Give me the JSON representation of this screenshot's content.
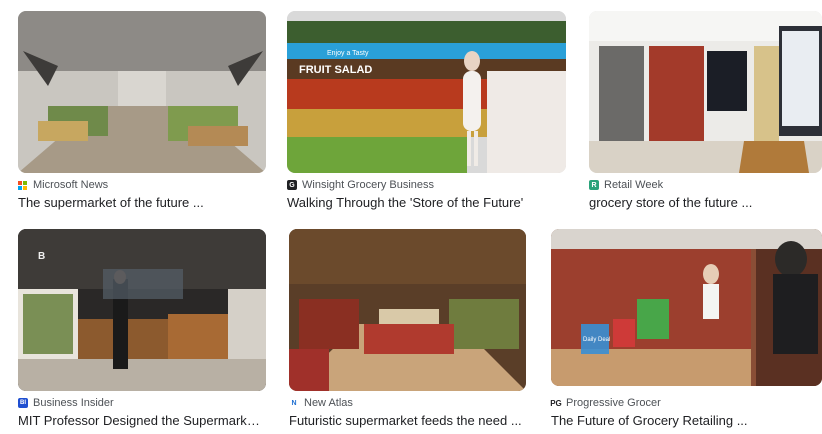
{
  "results": [
    {
      "source": "Microsoft News",
      "title": "The supermarket of the future ...",
      "icon": "microsoft-logo-icon",
      "icon_text": ""
    },
    {
      "source": "Winsight Grocery Business",
      "title": "Walking Through the 'Store of the Future'",
      "icon": "winsight-logo-icon",
      "icon_text": "G"
    },
    {
      "source": "Retail Week",
      "title": "grocery store of the future ...",
      "icon": "retail-week-logo-icon",
      "icon_text": "R"
    },
    {
      "source": "Business Insider",
      "title": "MIT Professor Designed the Supermarket...",
      "icon": "business-insider-logo-icon",
      "icon_text": "BI"
    },
    {
      "source": "New Atlas",
      "title": "Futuristic supermarket feeds the need ...",
      "icon": "new-atlas-logo-icon",
      "icon_text": "N"
    },
    {
      "source": "Progressive Grocer",
      "title": "The Future of Grocery Retailing ...",
      "icon": "progressive-grocer-logo-icon",
      "icon_text": "PG"
    }
  ],
  "image_text": {
    "fruit_salad": "FRUIT SALAD",
    "enjoy": "Enjoy a Tasty",
    "daily_deal": "Daily Deal",
    "bi_letter": "B"
  },
  "colors": {
    "ms_red": "#f25022",
    "ms_green": "#7fba00",
    "ms_blue": "#00a4ef",
    "ms_yellow": "#ffb900",
    "winsight": "#202124",
    "retail_week": "#2aa37a",
    "business_insider": "#1f4fd1",
    "new_atlas": "#1f6fd1",
    "progressive_grocer": "#202124"
  }
}
